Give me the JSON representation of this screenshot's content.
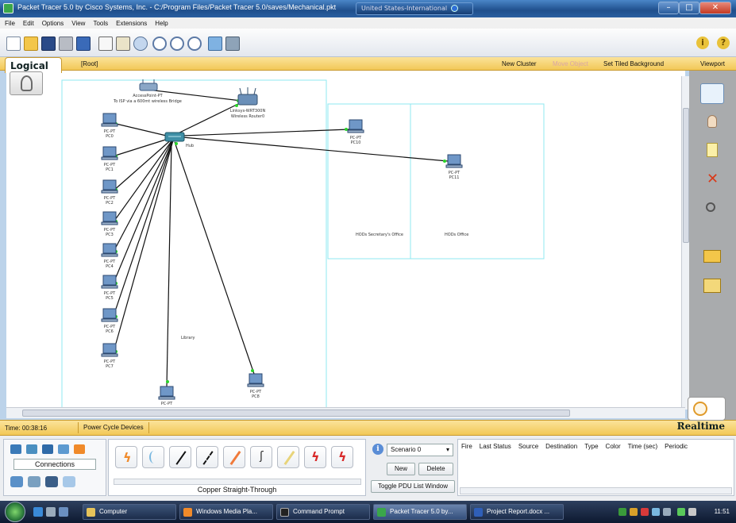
{
  "window": {
    "title": "Packet Tracer 5.0 by Cisco Systems, Inc. - C:/Program Files/Packet Tracer 5.0/saves/Mechanical.pkt",
    "keyboard_layout": "United States-International",
    "controls": [
      "minimize",
      "maximize",
      "close"
    ]
  },
  "menu": [
    "File",
    "Edit",
    "Options",
    "View",
    "Tools",
    "Extensions",
    "Help"
  ],
  "toolbar": {
    "icons": [
      "new-icon",
      "open-icon",
      "save-icon",
      "print-icon",
      "activity-wizard-icon",
      "copy-icon",
      "paste-icon",
      "undo-icon",
      "zoom-in-icon",
      "zoom-reset-icon",
      "zoom-out-icon",
      "drawing-palette-icon",
      "custom-device-icon",
      "info-icon",
      "help-icon"
    ]
  },
  "logical_bar": {
    "tab": "Logical",
    "root": "[Root]",
    "new_cluster": "New Cluster",
    "move_object": "Move Object",
    "set_tiled_background": "Set Tiled Background",
    "viewport": "Viewport"
  },
  "topology": {
    "access_point": {
      "name": "AccessPoint-PT",
      "note": "To ISP via a 600mt wireless Bridge"
    },
    "router": {
      "name": "Linksys-WRT300N",
      "subtitle": "Wireless Router0"
    },
    "hub_label": "Hub",
    "pcs_left": [
      {
        "type": "PC-PT",
        "name": "PC0"
      },
      {
        "type": "PC-PT",
        "name": "PC1"
      },
      {
        "type": "PC-PT",
        "name": "PC2"
      },
      {
        "type": "PC-PT",
        "name": "PC3"
      },
      {
        "type": "PC-PT",
        "name": "PC4"
      },
      {
        "type": "PC-PT",
        "name": "PC5"
      },
      {
        "type": "PC-PT",
        "name": "PC6"
      },
      {
        "type": "PC-PT",
        "name": "PC7"
      }
    ],
    "pc_bottom_1": {
      "type": "PC-PT",
      "name": ""
    },
    "pc_bottom_2": {
      "type": "PC-PT",
      "name": "PC8"
    },
    "pc10": {
      "type": "PC-PT",
      "name": "PC10"
    },
    "pc11": {
      "type": "PC-PT",
      "name": "PC11"
    },
    "library_label": "Library",
    "secretary_label": "HODs Secretary's Office",
    "hod_label": "HODs Office"
  },
  "time_bar": {
    "time": "Time: 00:38:16",
    "power_cycle": "Power Cycle Devices",
    "mode": "Realtime"
  },
  "device_panel": {
    "category_label": "Connections"
  },
  "connections": {
    "selected_name": "Copper Straight-Through",
    "types": [
      "automatic-connection-icon",
      "console-cable-icon",
      "copper-straight-through-icon",
      "copper-cross-over-icon",
      "fiber-icon",
      "phone-cable-icon",
      "coaxial-cable-icon",
      "serial-dce-icon",
      "serial-dte-icon"
    ]
  },
  "scenario": {
    "select": "Scenario 0",
    "new": "New",
    "delete": "Delete",
    "toggle": "Toggle PDU List Window"
  },
  "pdu_table": {
    "columns": [
      "Fire",
      "Last Status",
      "Source",
      "Destination",
      "Type",
      "Color",
      "Time (sec)",
      "Periodic"
    ]
  },
  "taskbar": {
    "tasks": [
      {
        "label": "Computer",
        "active": false
      },
      {
        "label": "Windows Media Pla...",
        "active": false
      },
      {
        "label": "Command Prompt",
        "active": false
      },
      {
        "label": "Packet Tracer 5.0 by...",
        "active": true
      },
      {
        "label": "Project Report.docx ...",
        "active": false
      }
    ],
    "clock": "11:51"
  },
  "colors": {
    "bar_yellow": "#f2c857",
    "link_green": "#2bd42b",
    "cluster_border": "#8fe8f0",
    "palette_gray": "#a9abad"
  }
}
